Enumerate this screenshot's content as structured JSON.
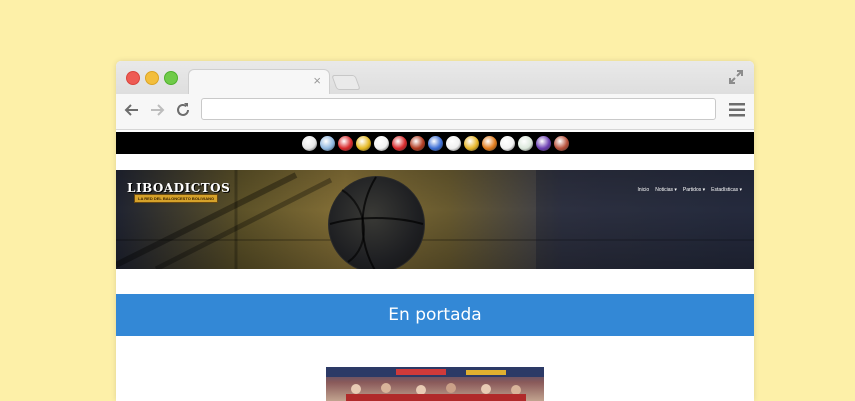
{
  "browser": {
    "tab": {
      "title": "",
      "close_glyph": "×"
    },
    "address_bar": {
      "value": "",
      "placeholder": ""
    },
    "icons": [
      "back-arrow-icon",
      "forward-arrow-icon",
      "reload-icon",
      "menu-icon",
      "expand-icon"
    ]
  },
  "site": {
    "logo": {
      "title": "LIBOADICTOS",
      "tagline": "LA RED DEL BALONCESTO BOLIVIANO"
    },
    "teams_bar": {
      "logo_colors": [
        "#e8e8e8",
        "#8fb7e0",
        "#d8282a",
        "#e5b820",
        "#f2f2f2",
        "#d8282a",
        "#b03a20",
        "#3d6fd6",
        "#f0f0f0",
        "#e7b528",
        "#e07a1a",
        "#f2f2f2",
        "#dce8dc",
        "#6c3fb3",
        "#b8503a"
      ]
    },
    "nav": [
      {
        "label": "Inicio"
      },
      {
        "label": "Noticias ▾"
      },
      {
        "label": "Partidos ▾"
      },
      {
        "label": "Estadísticas ▾"
      }
    ],
    "section_title": "En portada"
  },
  "colors": {
    "page_background": "#fdf0a8",
    "banner_blue": "#3388d6",
    "tagline_gold": "#d6a22a"
  }
}
